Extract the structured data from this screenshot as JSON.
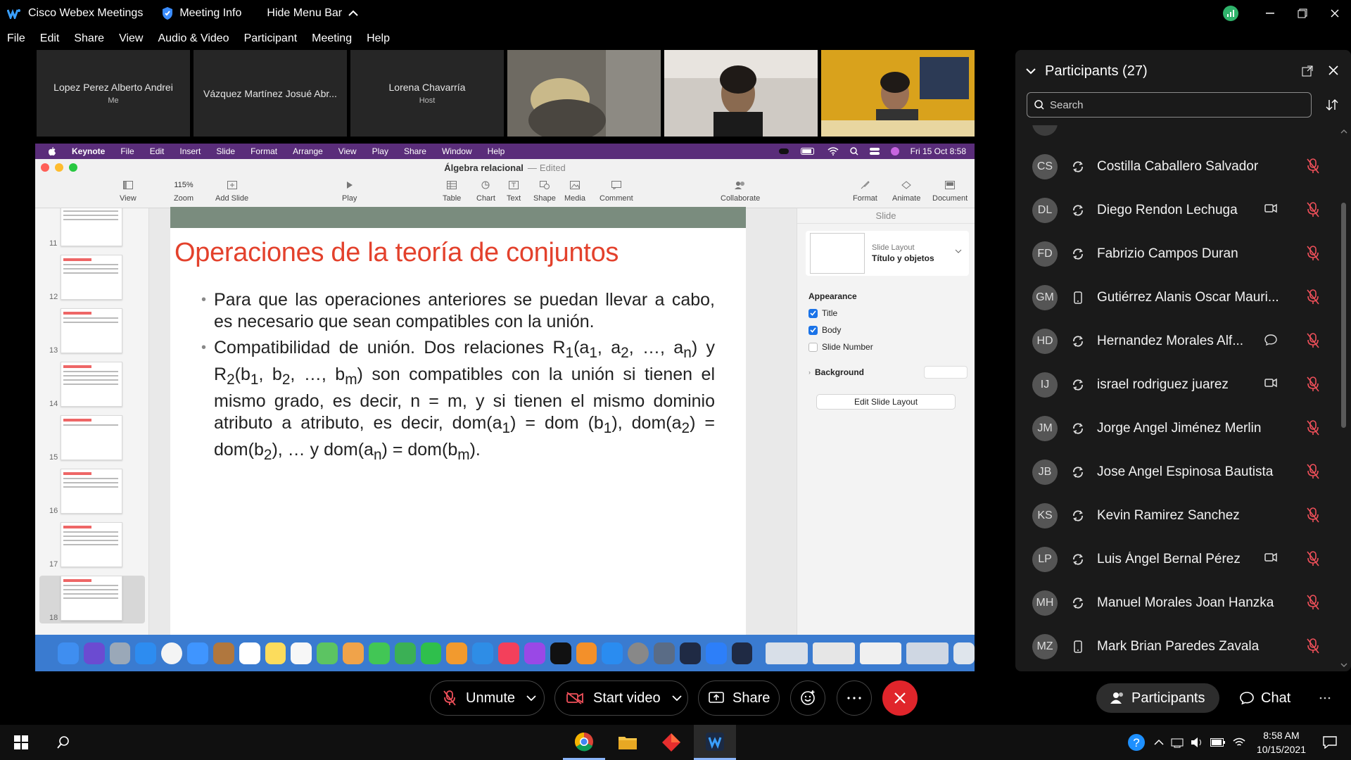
{
  "window": {
    "app_title": "Cisco Webex Meetings",
    "meeting_info": "Meeting Info",
    "hide_menu_bar": "Hide Menu Bar"
  },
  "menu": [
    "File",
    "Edit",
    "Share",
    "View",
    "Audio & Video",
    "Participant",
    "Meeting",
    "Help"
  ],
  "thumbnails": [
    {
      "name": "Lopez Perez Alberto Andrei",
      "role": "Me"
    },
    {
      "name": "Vázquez Martínez Josué Abr...",
      "role": ""
    },
    {
      "name": "Lorena Chavarría",
      "role": "Host"
    }
  ],
  "shared_screen": {
    "mac_menu": [
      "Keynote",
      "File",
      "Edit",
      "Insert",
      "Slide",
      "Format",
      "Arrange",
      "View",
      "Play",
      "Share",
      "Window",
      "Help"
    ],
    "mac_datetime": "Fri 15 Oct 8:58",
    "doc_title": "Álgebra relacional",
    "doc_status": "Edited",
    "toolbar": {
      "view": "View",
      "zoom_value": "115%",
      "zoom": "Zoom",
      "add_slide": "Add Slide",
      "play": "Play",
      "table": "Table",
      "chart": "Chart",
      "text": "Text",
      "shape": "Shape",
      "media": "Media",
      "comment": "Comment",
      "collaborate": "Collaborate",
      "format": "Format",
      "animate": "Animate",
      "document": "Document"
    },
    "slide_numbers": [
      "11",
      "12",
      "13",
      "14",
      "15",
      "16",
      "17",
      "18"
    ],
    "slide": {
      "title": "Operaciones de la teoría de conjuntos",
      "bullet1": "Para que las operaciones anteriores se puedan llevar a cabo, es necesario que sean compatibles con la unión.",
      "bullet2_a": "Compatibilidad de unión. Dos relaciones R",
      "bullet2_b": "(a",
      "bullet2_c": ", a",
      "bullet2_d": ", …, a",
      "bullet2_e": ") y R",
      "bullet2_f": "(b",
      "bullet2_g": ", b",
      "bullet2_h": ", …, b",
      "bullet2_i": ") son compatibles con la unión si tienen el mismo grado, es decir, n = m, y si tienen el mismo dominio atributo a atributo, es decir, dom(a",
      "bullet2_j": ") = dom (b",
      "bullet2_k": "), dom(a",
      "bullet2_l": ") = dom(b",
      "bullet2_m": "), … y dom(a",
      "bullet2_n": ") = dom(b",
      "bullet2_o": ").",
      "sub1": "1",
      "sub2": "2",
      "subn": "n",
      "subm": "m"
    },
    "inspector": {
      "tab": "Slide",
      "layout_label": "Slide Layout",
      "layout_value": "Título y objetos",
      "appearance": "Appearance",
      "title_cb": "Title",
      "body_cb": "Body",
      "slide_number_cb": "Slide Number",
      "background": "Background",
      "edit_layout": "Edit Slide Layout"
    }
  },
  "participants": {
    "header": "Participants (27)",
    "search_placeholder": "Search",
    "list": [
      {
        "initials": "CS",
        "name": "Costilla Caballero Salvador",
        "device": "sync",
        "extra": ""
      },
      {
        "initials": "DL",
        "name": "Diego Rendon Lechuga",
        "device": "sync",
        "extra": "video"
      },
      {
        "initials": "FD",
        "name": "Fabrizio Campos Duran",
        "device": "sync",
        "extra": ""
      },
      {
        "initials": "GM",
        "name": "Gutiérrez Alanis Oscar Mauri...",
        "device": "phone",
        "extra": ""
      },
      {
        "initials": "HD",
        "name": "Hernandez Morales Alf...",
        "device": "sync",
        "extra": "chat"
      },
      {
        "initials": "IJ",
        "name": "israel rodriguez juarez",
        "device": "sync",
        "extra": "video"
      },
      {
        "initials": "JM",
        "name": "Jorge Angel Jiménez Merlin",
        "device": "sync",
        "extra": ""
      },
      {
        "initials": "JB",
        "name": "Jose Angel Espinosa Bautista",
        "device": "sync",
        "extra": ""
      },
      {
        "initials": "KS",
        "name": "Kevin Ramirez Sanchez",
        "device": "sync",
        "extra": ""
      },
      {
        "initials": "LP",
        "name": "Luis Ángel Bernal Pérez",
        "device": "sync",
        "extra": "video"
      },
      {
        "initials": "MH",
        "name": "Manuel Morales Joan Hanzka",
        "device": "sync",
        "extra": ""
      },
      {
        "initials": "MZ",
        "name": "Mark Brian Paredes Zavala",
        "device": "phone",
        "extra": ""
      }
    ]
  },
  "controls": {
    "unmute": "Unmute",
    "start_video": "Start video",
    "share": "Share",
    "participants": "Participants",
    "chat": "Chat"
  },
  "taskbar": {
    "time": "8:58 AM",
    "date": "10/15/2021"
  },
  "colors": {
    "end_call": "#e0252b",
    "mute_red": "#f0505a",
    "slide_title": "#e3412c",
    "dock_blue": "#3a7bd0"
  }
}
